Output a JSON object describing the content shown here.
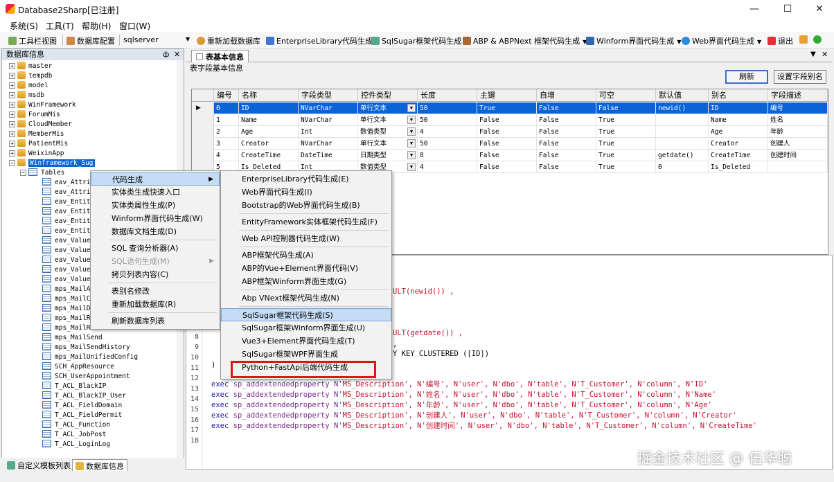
{
  "window": {
    "title": "Database2Sharp[已注册]"
  },
  "menubar": [
    "系统(S)",
    "工具(T)",
    "帮助(H)",
    "窗口(W)"
  ],
  "toolbar": {
    "items": [
      "工具栏视图",
      "数据库配置",
      "sqlserver",
      "重新加载数据库",
      "EnterpriseLibrary代码生成",
      "SqlSugar框架代码生成",
      "ABP & ABPNext 框架代码生成",
      "Winform界面代码生成",
      "Web界面代码生成",
      "退出"
    ]
  },
  "left_panel": {
    "title": "数据库信息",
    "pin": "ф",
    "close": "✕",
    "databases": [
      "master",
      "tempdb",
      "model",
      "msdb",
      "WinFramework",
      "ForumMis",
      "CloudMember",
      "MemberMis",
      "PatientMis",
      "WeixinApp",
      "Winframework_Sug"
    ],
    "tables_label": "Tables",
    "tables": [
      "eav_Attrib",
      "eav_Attrib",
      "eav_Entity",
      "eav_Entity",
      "eav_Entity",
      "eav_Entity",
      "eav_Value_",
      "eav_Value_",
      "eav_Value_",
      "eav_Value_",
      "eav_Value_",
      "mps_MailAt",
      "mps_MailCo",
      "mps_MailDe",
      "mps_MailRe",
      "mps_MailReceiveTask",
      "mps_MailSend",
      "mps_MailSendHistory",
      "mps_MailUnifiedConfig",
      "SCH_AppResource",
      "SCH_UserAppointment",
      "T_ACL_BlackIP",
      "T_ACL_BlackIP_User",
      "T_ACL_FieldDomain",
      "T_ACL_FieldPermit",
      "T_ACL_Function",
      "T_ACL_JobPost",
      "T_ACL_LoginLog"
    ]
  },
  "bottom_tabs": [
    "自定义模板列表",
    "数据库信息"
  ],
  "right_panel": {
    "tab": "表基本信息",
    "section_label": "表字段基本信息",
    "refresh_button": "刷新",
    "set_alias_button": "设置字段别名",
    "columns": [
      "编号",
      "名称",
      "字段类型",
      "控件类型",
      "长度",
      "主键",
      "自增",
      "可空",
      "默认值",
      "别名",
      "字段描述"
    ],
    "rows": [
      [
        "0",
        "ID",
        "NVarChar",
        "单行文本",
        "50",
        "True",
        "False",
        "False",
        "newid()",
        "ID",
        "编号"
      ],
      [
        "1",
        "Name",
        "NVarChar",
        "单行文本",
        "50",
        "False",
        "False",
        "True",
        "",
        "Name",
        "姓名"
      ],
      [
        "2",
        "Age",
        "Int",
        "数值类型",
        "4",
        "False",
        "False",
        "True",
        "",
        "Age",
        "年龄"
      ],
      [
        "3",
        "Creator",
        "NVarChar",
        "单行文本",
        "50",
        "False",
        "False",
        "True",
        "",
        "Creator",
        "创建人"
      ],
      [
        "4",
        "CreateTime",
        "DateTime",
        "日期类型",
        "8",
        "False",
        "False",
        "True",
        "getdate()",
        "CreateTime",
        "创建时间"
      ],
      [
        "5",
        "Is_Deleted",
        "Int",
        "数值类型",
        "4",
        "False",
        "False",
        "True",
        "0",
        "Is_Deleted",
        ""
      ]
    ]
  },
  "code": {
    "partial_lines": [
      {
        "num": "",
        "text": "ULT(newid())  ,"
      },
      {
        "num": "",
        "text": "ULT(getdate())  ,"
      },
      {
        "num": "",
        "text": ","
      },
      {
        "num": "",
        "text": "Y KEY CLUSTERED ([ID])"
      }
    ],
    "line_numbers": [
      "8",
      "9",
      "10",
      "11",
      "12",
      "13",
      "14",
      "15",
      "16",
      "17",
      "18"
    ],
    "paren_line": ")",
    "exec_lines": [
      {
        "num": "13",
        "a": "exec",
        "b": "sp_addextendedproperty N'",
        "c": "MS_Description', N'编号', N'user', N'dbo', N'table', N'T_Customer', N'column', N'ID'"
      },
      {
        "num": "14",
        "a": "exec",
        "b": "sp_addextendedproperty N'",
        "c": "MS_Description', N'姓名', N'user', N'dbo', N'table', N'T_Customer', N'column', N'Name'"
      },
      {
        "num": "15",
        "a": "exec",
        "b": "sp_addextendedproperty N'",
        "c": "MS_Description', N'年龄', N'user', N'dbo', N'table', N'T_Customer', N'column', N'Age'"
      },
      {
        "num": "16",
        "a": "exec",
        "b": "sp_addextendedproperty N'",
        "c": "MS_Description', N'创建人', N'user', N'dbo', N'table', N'T_Customer', N'column', N'Creator'"
      },
      {
        "num": "17",
        "a": "exec",
        "b": "sp_addextendedproperty N'",
        "c": "MS_Description', N'创建时间', N'user', N'dbo', N'table', N'T_Customer', N'column', N'CreateTime'"
      }
    ]
  },
  "context_menu": {
    "items": [
      "代码生成",
      "实体类生成快速入口",
      "实体类属性生成(P)",
      "Winform界面代码生成(W)",
      "数据库文档生成(D)",
      "SQL 查询分析器(A)",
      "SQL语句生成(M)",
      "拷贝列表内容(C)",
      "表别名修改",
      "重新加载数据库(R)",
      "刷新数据库列表"
    ]
  },
  "sub_menu": {
    "items": [
      "EnterpriseLibrary代码生成(E)",
      "Web界面代码生成(I)",
      "Bootstrap的Web界面代码生成(B)",
      "EntityFramework实体框架代码生成(F)",
      "Web API控制器代码生成(W)",
      "ABP框架代码生成(A)",
      "ABP的Vue+Element界面代码(V)",
      "ABP框架Winform界面生成(G)",
      "Abp VNext框架代码生成(N)",
      "SqlSugar框架代码生成(S)",
      "SqlSugar框架Winform界面生成(U)",
      "Vue3+Element界面代码生成(T)",
      "SqlSugar框架WPF界面生成",
      "Python+FastApi后端代码生成"
    ]
  },
  "watermark": "掘金技术社区 @ 伍华聪",
  "colors": {
    "selection": "#0a64d7",
    "highlight_box": "#e01414"
  }
}
